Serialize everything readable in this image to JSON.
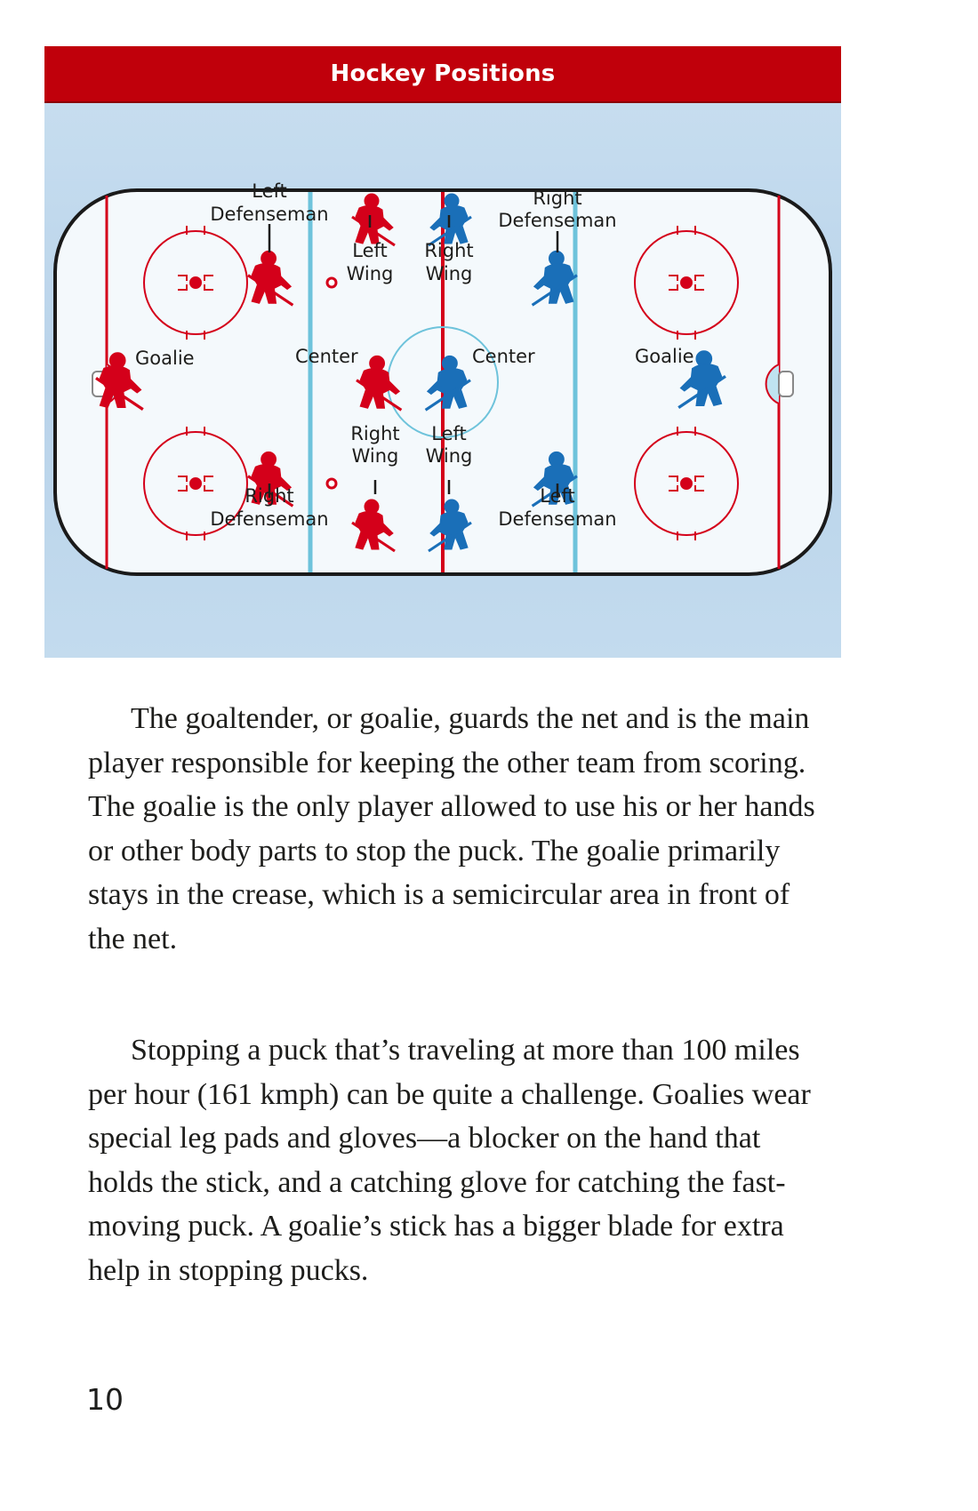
{
  "figure": {
    "title": "Hockey Positions",
    "colors": {
      "banner": "#c0000b",
      "home_team": "#d4001a",
      "away_team": "#1a6fb8",
      "ice": "#f4f9fc",
      "lines_red": "#d4001a",
      "lines_blue": "#6ec3db"
    },
    "labels": {
      "left_goalie": "Goalie",
      "left_center": "Center",
      "right_center": "Center",
      "right_goalie": "Goalie",
      "red_left_defenseman": [
        "Left",
        "Defenseman"
      ],
      "red_right_defenseman": [
        "Right",
        "Defenseman"
      ],
      "red_left_wing": [
        "Left",
        "Wing"
      ],
      "red_right_wing": [
        "Right",
        "Wing"
      ],
      "blue_right_wing": [
        "Right",
        "Wing"
      ],
      "blue_left_wing": [
        "Left",
        "Wing"
      ],
      "blue_right_defenseman": [
        "Right",
        "Defenseman"
      ],
      "blue_left_defenseman": [
        "Left",
        "Defenseman"
      ]
    },
    "icons": [
      "player-red-icon",
      "player-blue-icon",
      "faceoff-dot-icon",
      "net-icon"
    ]
  },
  "paragraphs": [
    "The goaltender, or goalie, guards the net and is the main player responsible for keeping the other team from scoring. The goalie is the only player allowed to use his or her hands or other body parts to stop the puck. The goalie primarily stays in the crease, which is a semicircular area in front of the net.",
    "Stopping a puck that’s traveling at more than 100 miles per hour (161 kmph) can be quite a challenge. Goalies wear special leg pads and gloves—a blocker on the hand that holds the stick, and a catching glove for catching the fast-moving puck. A goalie’s stick has a bigger blade for extra help in stopping pucks."
  ],
  "page_number": "10"
}
